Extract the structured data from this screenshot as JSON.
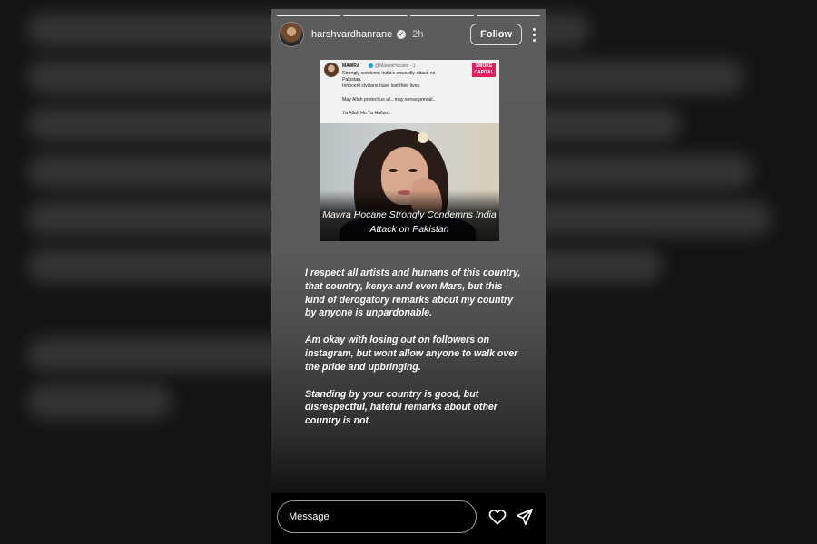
{
  "header": {
    "username": "harshvardhanrane",
    "verified": true,
    "time": "2h",
    "follow_label": "Follow",
    "progress_segments": 4,
    "progress_done": 3
  },
  "embedded_post": {
    "tweet": {
      "name": "MAWRA",
      "handle": "@MawraHocane · 1",
      "lines": [
        "Strongly condemn India's cowardly attack on",
        "Pakistan.",
        "Innocent civilians have lost their lives.",
        "May Allah protect us all.. may sense prevail..",
        "Ya Allah Ho Ya Hafizo.."
      ],
      "logo_text": "SMOKE CAPITAL"
    },
    "caption_line1": "Mawra Hocane Strongly Condemns India",
    "caption_line2": "Attack on Pakistan"
  },
  "story_text": {
    "paragraphs": [
      "I respect all artists and humans of this country, that country, kenya and even Mars, but this kind of derogatory remarks about my country by anyone is unpardonable.",
      "Am okay with losing out on followers on instagram, but wont allow anyone to walk over the pride and upbringing.",
      "Standing by your country is good, but disrespectful, hateful remarks about other country is not."
    ]
  },
  "footer": {
    "message_placeholder": "Message",
    "icons": [
      "heart-icon",
      "send-icon",
      "more-vertical-icon",
      "verified-badge-icon"
    ]
  },
  "colors": {
    "backdrop": "#141414",
    "story_top": "#5c5c5c",
    "footer": "#000000",
    "tweet_link": "#1d9bf0",
    "logo_pink": "#e0205f"
  }
}
